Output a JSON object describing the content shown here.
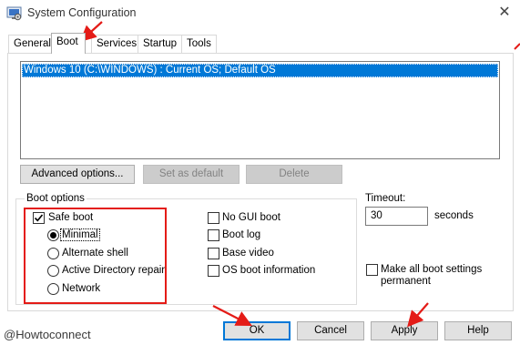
{
  "window": {
    "title": "System Configuration",
    "close_glyph": "✕"
  },
  "tabs": [
    {
      "label": "General"
    },
    {
      "label": "Boot"
    },
    {
      "label": "Services"
    },
    {
      "label": "Startup"
    },
    {
      "label": "Tools"
    }
  ],
  "os_list": {
    "items": [
      "Windows 10 (C:\\WINDOWS) : Current OS; Default OS"
    ],
    "selected_index": 0
  },
  "buttons": {
    "advanced_options": "Advanced options...",
    "set_as_default": "Set as default",
    "delete": "Delete",
    "ok": "OK",
    "cancel": "Cancel",
    "apply": "Apply",
    "help": "Help"
  },
  "boot_options": {
    "label": "Boot options",
    "safe_boot": {
      "label": "Safe boot",
      "checked": true
    },
    "radios": [
      {
        "label": "Minimal",
        "selected": true
      },
      {
        "label": "Alternate shell",
        "selected": false
      },
      {
        "label": "Active Directory repair",
        "selected": false
      },
      {
        "label": "Network",
        "selected": false
      }
    ],
    "checks": [
      {
        "label": "No GUI boot",
        "checked": false
      },
      {
        "label": "Boot log",
        "checked": false
      },
      {
        "label": "Base video",
        "checked": false
      },
      {
        "label": "OS boot information",
        "checked": false
      }
    ]
  },
  "timeout": {
    "label": "Timeout:",
    "value": "30",
    "unit": "seconds"
  },
  "make_permanent": {
    "line1": "Make all boot settings",
    "line2": "permanent",
    "checked": false
  },
  "watermark": "@Howtoconnect",
  "colors": {
    "selection": "#0078d7",
    "annotation_red": "#e41b17",
    "button_face": "#e1e1e1"
  }
}
